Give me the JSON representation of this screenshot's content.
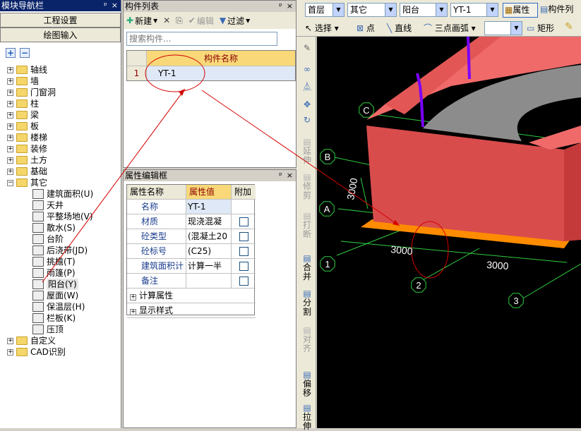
{
  "nav": {
    "title": "模块导航栏",
    "pin": "ᵖ",
    "close": "×",
    "btn_project": "工程设置",
    "btn_drawing": "绘图输入",
    "plus": "+",
    "minus": "−",
    "tree": [
      {
        "label": "轴线",
        "type": "folder",
        "exp": "+"
      },
      {
        "label": "墙",
        "type": "folder",
        "exp": "+"
      },
      {
        "label": "门窗洞",
        "type": "folder",
        "exp": "+"
      },
      {
        "label": "柱",
        "type": "folder",
        "exp": "+"
      },
      {
        "label": "梁",
        "type": "folder",
        "exp": "+"
      },
      {
        "label": "板",
        "type": "folder",
        "exp": "+"
      },
      {
        "label": "楼梯",
        "type": "folder",
        "exp": "+"
      },
      {
        "label": "装修",
        "type": "folder",
        "exp": "+"
      },
      {
        "label": "土方",
        "type": "folder",
        "exp": "+"
      },
      {
        "label": "基础",
        "type": "folder",
        "exp": "+"
      },
      {
        "label": "其它",
        "type": "folder",
        "exp": "−"
      },
      {
        "label": "建筑面积(U)",
        "type": "leaf"
      },
      {
        "label": "天井",
        "type": "leaf"
      },
      {
        "label": "平整场地(V)",
        "type": "leaf"
      },
      {
        "label": "散水(S)",
        "type": "leaf"
      },
      {
        "label": "台阶",
        "type": "leaf"
      },
      {
        "label": "后浇带(JD)",
        "type": "leaf"
      },
      {
        "label": "挑檐(T)",
        "type": "leaf"
      },
      {
        "label": "雨篷(P)",
        "type": "leaf"
      },
      {
        "label": "阳台(Y)",
        "type": "leaf",
        "selected": true
      },
      {
        "label": "屋面(W)",
        "type": "leaf"
      },
      {
        "label": "保温层(H)",
        "type": "leaf"
      },
      {
        "label": "栏板(K)",
        "type": "leaf"
      },
      {
        "label": "压顶",
        "type": "leaf"
      },
      {
        "label": "自定义",
        "type": "folder",
        "exp": "+"
      },
      {
        "label": "CAD识别",
        "type": "folder",
        "exp": "+"
      }
    ]
  },
  "complist": {
    "title": "构件列表",
    "new": "新建",
    "edit": "编辑",
    "filter": "过滤",
    "search_placeholder": "搜索构件...",
    "col_header": "构件名称",
    "rows": [
      {
        "num": "1",
        "name": "YT-1"
      }
    ]
  },
  "props": {
    "title": "属性编辑框",
    "col_name": "属性名称",
    "col_value": "属性值",
    "col_extra": "附加",
    "rows": [
      {
        "name": "名称",
        "value": "YT-1",
        "check": false
      },
      {
        "name": "材质",
        "value": "现浇混凝",
        "check": true
      },
      {
        "name": "砼类型",
        "value": "(混凝土20",
        "check": true
      },
      {
        "name": "砼标号",
        "value": "(C25)",
        "check": true
      },
      {
        "name": "建筑面积计",
        "value": "计算一半",
        "check": true
      },
      {
        "name": "备注",
        "value": "",
        "check": true
      }
    ],
    "groups": [
      {
        "exp": "+",
        "label": "计算属性"
      },
      {
        "exp": "+",
        "label": "显示样式"
      }
    ]
  },
  "toolbar": {
    "floor": "首层",
    "category": "其它",
    "type": "阳台",
    "component": "YT-1",
    "properties": "属性",
    "complist": "构件列",
    "select": "选择",
    "point": "点",
    "line": "直线",
    "arc": "三点画弧",
    "rect": "矩形"
  },
  "vtools": [
    {
      "label": "延伸",
      "enabled": false
    },
    {
      "label": "修剪",
      "enabled": false
    },
    {
      "label": "打断",
      "enabled": false
    },
    {
      "label": "合并",
      "enabled": true
    },
    {
      "label": "分割",
      "enabled": true
    },
    {
      "label": "对齐",
      "enabled": false
    },
    {
      "label": "偏移",
      "enabled": true
    },
    {
      "label": "拉伸",
      "enabled": true
    }
  ],
  "canvas": {
    "axes": [
      "C",
      "B",
      "A",
      "1",
      "2",
      "3"
    ],
    "dims": [
      "3000",
      "3000",
      "3000"
    ]
  },
  "colors": {
    "wall": "#e35656",
    "slab": "#ff8c00",
    "grid": "#2ecc40",
    "title_blue": "#0a246a"
  }
}
